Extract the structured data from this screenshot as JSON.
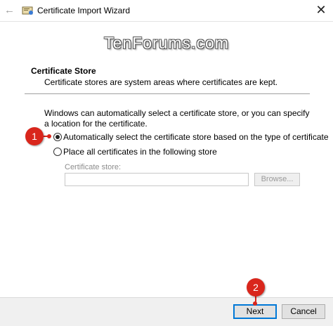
{
  "window": {
    "title": "Certificate Import Wizard",
    "close_glyph": "✕",
    "back_glyph": "←"
  },
  "watermark": "TenForums.com",
  "header": {
    "title": "Certificate Store",
    "description": "Certificate stores are system areas where certificates are kept."
  },
  "body": {
    "intro": "Windows can automatically select a certificate store, or you can specify a location for the certificate.",
    "options": [
      {
        "label": "Automatically select the certificate store based on the type of certificate",
        "selected": true
      },
      {
        "label": "Place all certificates in the following store",
        "selected": false
      }
    ],
    "store_label": "Certificate store:",
    "store_value": "",
    "browse_label": "Browse..."
  },
  "footer": {
    "next_label": "Next",
    "cancel_label": "Cancel"
  },
  "annotations": {
    "badge1": "1",
    "badge2": "2",
    "accent": "#d9261c"
  }
}
